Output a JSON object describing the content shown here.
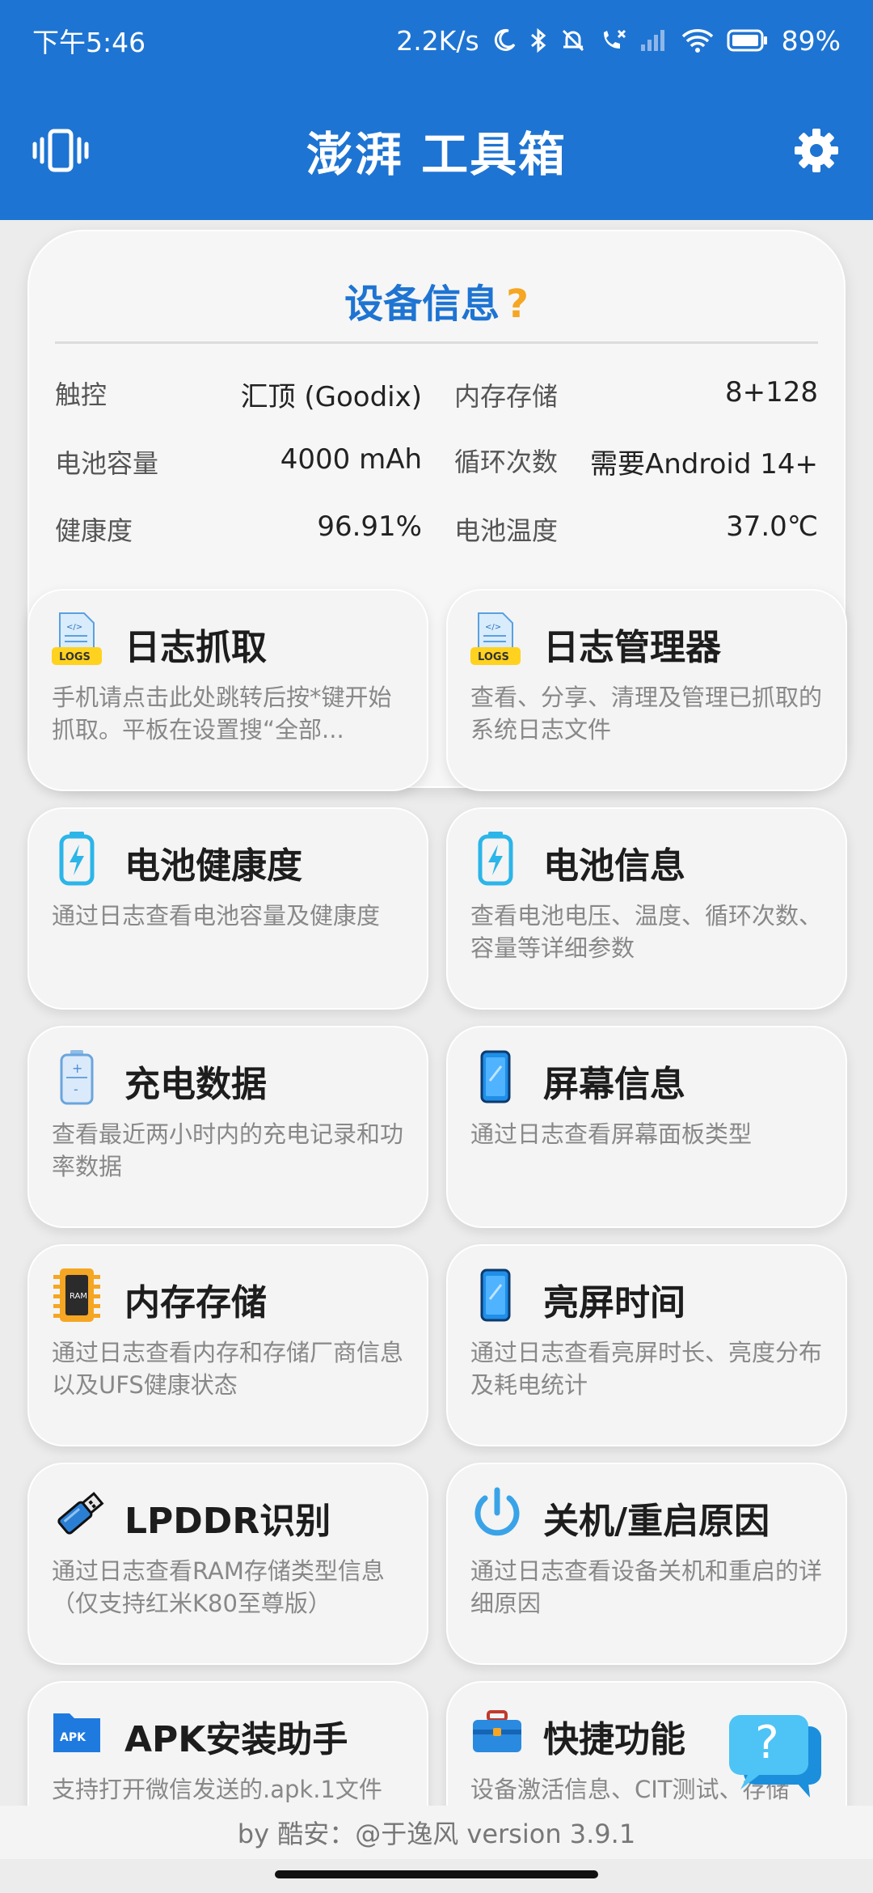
{
  "status_bar": {
    "time": "下午5:46",
    "speed": "2.2K/s",
    "battery": "89%"
  },
  "app_bar": {
    "title": "澎湃 工具箱",
    "left_icon": "vibrate-icon",
    "right_icon": "gear-icon"
  },
  "device_info": {
    "title": "设备信息",
    "help_icon": "?",
    "rows": [
      [
        {
          "label": "触控",
          "value": "汇顶 (Goodix)"
        },
        {
          "label": "内存存储",
          "value": "8+128"
        }
      ],
      [
        {
          "label": "电池容量",
          "value": "4000 mAh"
        },
        {
          "label": "循环次数",
          "value": "需要Android 14+"
        }
      ],
      [
        {
          "label": "健康度",
          "value": "96.91%"
        },
        {
          "label": "电池温度",
          "value": "37.0℃"
        }
      ]
    ]
  },
  "tools": [
    {
      "title": "日志抓取",
      "desc": "手机请点击此处跳转后按*键开始抓取。平板在设置搜“全部...",
      "icon": "logs-icon"
    },
    {
      "title": "日志管理器",
      "desc": "查看、分享、清理及管理已抓取的系统日志文件",
      "icon": "logs-icon"
    },
    {
      "title": "电池健康度",
      "desc": "通过日志查看电池容量及健康度",
      "icon": "battery-bolt-icon"
    },
    {
      "title": "电池信息",
      "desc": "查看电池电压、温度、循环次数、容量等详细参数",
      "icon": "battery-bolt-icon"
    },
    {
      "title": "充电数据",
      "desc": "查看最近两小时内的充电记录和功率数据",
      "icon": "battery-icon"
    },
    {
      "title": "屏幕信息",
      "desc": "通过日志查看屏幕面板类型",
      "icon": "phone-icon"
    },
    {
      "title": "内存存储",
      "desc": "通过日志查看内存和存储厂商信息以及UFS健康状态",
      "icon": "ram-chip-icon"
    },
    {
      "title": "亮屏时间",
      "desc": "通过日志查看亮屏时长、亮度分布及耗电统计",
      "icon": "phone-icon"
    },
    {
      "title": "LPDDR识别",
      "desc": "通过日志查看RAM存储类型信息（仅支持红米K80至尊版）",
      "icon": "usb-stick-icon"
    },
    {
      "title": "关机/重启原因",
      "desc": "通过日志查看设备关机和重启的详细原因",
      "icon": "power-icon"
    },
    {
      "title": "APK安装助手",
      "desc": "支持打开微信发送的.apk.1文件",
      "icon": "apk-folder-icon"
    },
    {
      "title": "快捷功能",
      "desc": "设备激活信息、CIT测试、存储",
      "icon": "toolbox-icon"
    }
  ],
  "footer": {
    "text": "by 酷安：@于逸风 version 3.9.1"
  },
  "fab": {
    "icon": "help-chat-icon",
    "label": "?"
  }
}
